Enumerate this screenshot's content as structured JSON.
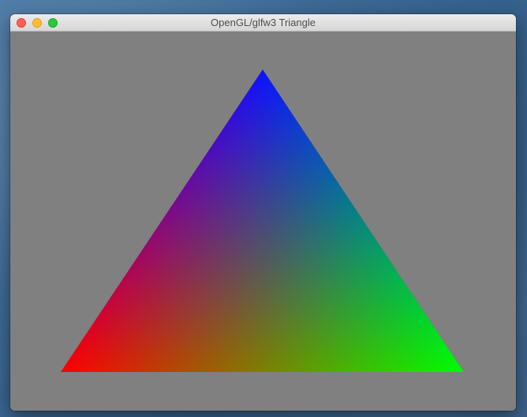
{
  "window": {
    "title": "OpenGL/glfw3 Triangle",
    "traffic_lights": [
      {
        "name": "close",
        "color": "#fe5f57"
      },
      {
        "name": "minimize",
        "color": "#febc2e"
      },
      {
        "name": "zoom",
        "color": "#28c840"
      }
    ]
  },
  "canvas": {
    "clear_color": "#808080",
    "triangle": {
      "vertex_colors": {
        "top": "#0000ff",
        "bottom_left": "#ff0000",
        "bottom_right": "#00ff00"
      }
    }
  }
}
